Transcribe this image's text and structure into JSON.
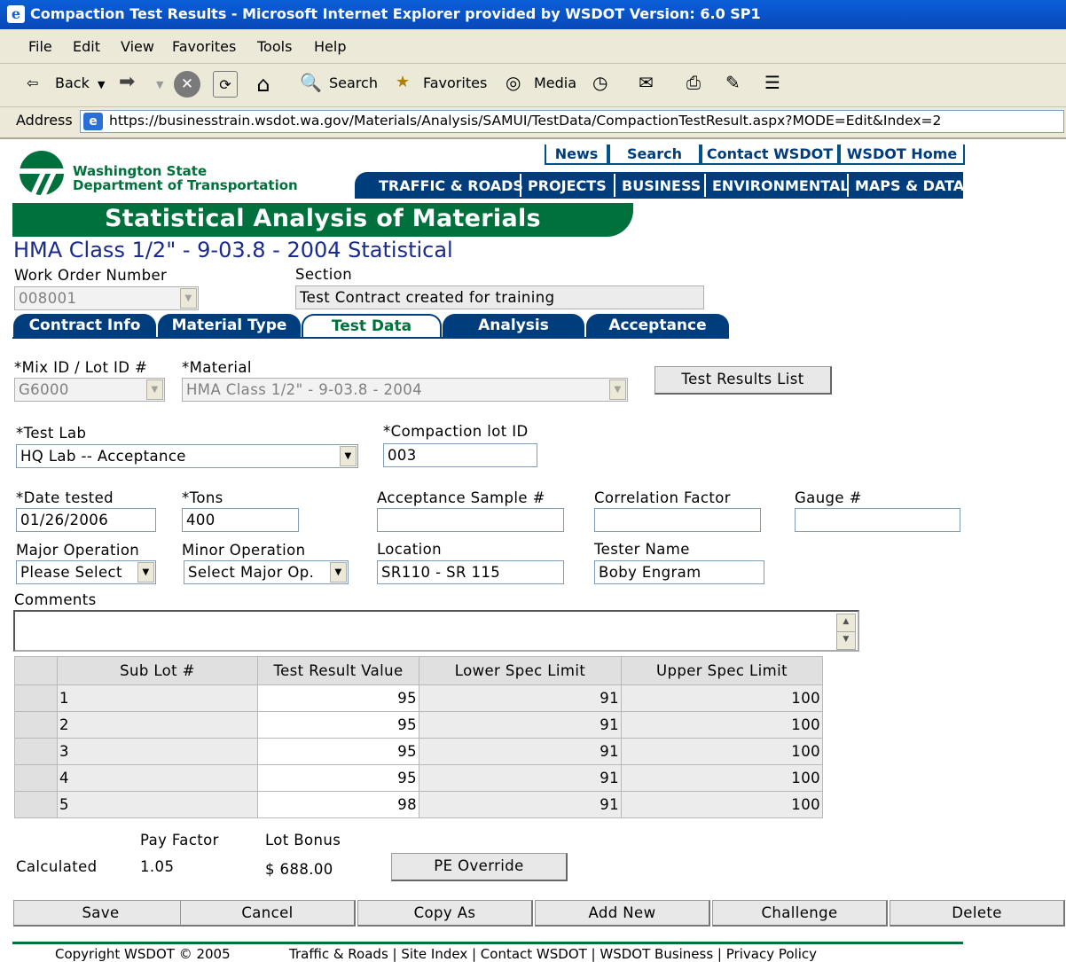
{
  "window": {
    "title": "Compaction Test Results - Microsoft Internet Explorer provided by WSDOT Version: 6.0 SP1"
  },
  "menu": [
    "File",
    "Edit",
    "View",
    "Favorites",
    "Tools",
    "Help"
  ],
  "toolbar": {
    "back": "Back",
    "search": "Search",
    "favorites": "Favorites",
    "media": "Media"
  },
  "address": {
    "label": "Address",
    "url": "https://businesstrain.wsdot.wa.gov/Materials/Analysis/SAMUI/TestData/CompactionTestResult.aspx?MODE=Edit&Index=2"
  },
  "header": {
    "agency_line1": "Washington State",
    "agency_line2": "Department of Transportation",
    "top_links": [
      "News",
      "Search",
      "Contact WSDOT",
      "WSDOT Home"
    ],
    "nav_tabs": [
      "TRAFFIC & ROADS",
      "PROJECTS",
      "BUSINESS",
      "ENVIRONMENTAL",
      "MAPS & DATA"
    ],
    "banner": "Statistical Analysis of Materials",
    "page_title": "HMA Class 1/2\" - 9-03.8 - 2004 Statistical"
  },
  "form": {
    "work_order_label": "Work Order Number",
    "work_order_value": "008001",
    "section_label": "Section",
    "section_value": "Test Contract created for training",
    "tabs": [
      "Contract Info",
      "Material Type",
      "Test Data",
      "Analysis",
      "Acceptance"
    ],
    "active_tab": "Test Data",
    "mix_label": "*Mix ID / Lot ID #",
    "mix_value": "G6000",
    "material_label": "*Material",
    "material_value": "HMA Class 1/2\" - 9-03.8 - 2004",
    "test_results_list_button": "Test Results List",
    "test_lab_label": "*Test Lab",
    "test_lab_value": "HQ Lab -- Acceptance",
    "compaction_lot_label": "*Compaction lot ID",
    "compaction_lot_value": "003",
    "date_label": "*Date tested",
    "date_value": "01/26/2006",
    "tons_label": "*Tons",
    "tons_value": "400",
    "acceptance_sample_label": "Acceptance Sample #",
    "acceptance_sample_value": "",
    "correlation_label": "Correlation Factor",
    "correlation_value": "",
    "gauge_label": "Gauge #",
    "gauge_value": "",
    "major_op_label": "Major Operation",
    "major_op_value": "Please Select",
    "minor_op_label": "Minor Operation",
    "minor_op_value": "Select Major Op.",
    "location_label": "Location",
    "location_value": "SR110 - SR 115",
    "tester_label": "Tester Name",
    "tester_value": "Boby Engram",
    "comments_label": "Comments",
    "comments_value": ""
  },
  "grid": {
    "headers": [
      "Sub Lot #",
      "Test Result Value",
      "Lower Spec Limit",
      "Upper Spec Limit"
    ],
    "rows": [
      {
        "sub_lot": "1",
        "value": "95",
        "lower": "91",
        "upper": "100"
      },
      {
        "sub_lot": "2",
        "value": "95",
        "lower": "91",
        "upper": "100"
      },
      {
        "sub_lot": "3",
        "value": "95",
        "lower": "91",
        "upper": "100"
      },
      {
        "sub_lot": "4",
        "value": "95",
        "lower": "91",
        "upper": "100"
      },
      {
        "sub_lot": "5",
        "value": "98",
        "lower": "91",
        "upper": "100"
      }
    ]
  },
  "results": {
    "pay_factor_label": "Pay Factor",
    "lot_bonus_label": "Lot Bonus",
    "calculated_label": "Calculated",
    "pay_factor_value": "1.05",
    "lot_bonus_value": "$ 688.00",
    "pe_override_button": "PE Override"
  },
  "actions": [
    "Save",
    "Cancel",
    "Copy As",
    "Add New",
    "Challenge",
    "Delete"
  ],
  "footer": {
    "copyright": "Copyright WSDOT © 2005",
    "links": "Traffic & Roads | Site Index | Contact WSDOT | WSDOT Business | Privacy Policy"
  }
}
